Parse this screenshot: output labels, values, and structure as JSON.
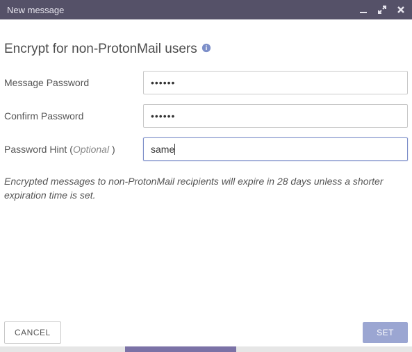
{
  "titlebar": {
    "title": "New message"
  },
  "heading": "Encrypt for non-ProtonMail users",
  "form": {
    "password_label": "Message Password",
    "password_value": "••••••",
    "confirm_label": "Confirm Password",
    "confirm_value": "••••••",
    "hint_label": "Password Hint",
    "hint_optional": "(",
    "hint_optional_word": "Optional",
    "hint_optional_close": ")",
    "hint_value": "same"
  },
  "note": "Encrypted messages to non-ProtonMail recipients will expire in 28 days unless a shorter expiration time is set.",
  "footer": {
    "cancel": "CANCEL",
    "set": "SET"
  }
}
